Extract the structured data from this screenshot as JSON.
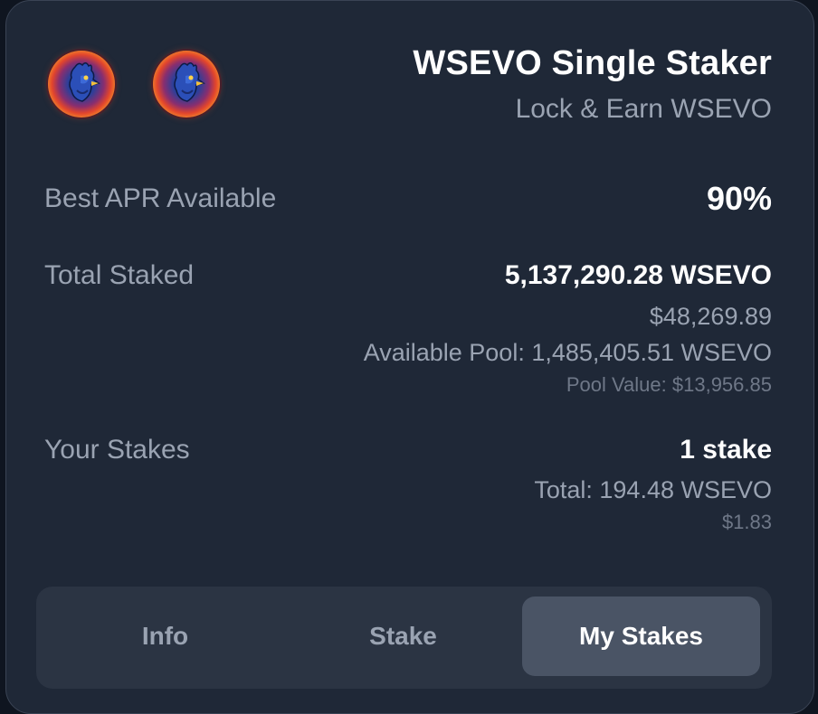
{
  "header": {
    "title": "WSEVO Single Staker",
    "subtitle": "Lock & Earn WSEVO",
    "icons": [
      "rooster-token-icon",
      "rooster-token-icon"
    ]
  },
  "stats": {
    "apr_label": "Best APR Available",
    "apr_value": "90%",
    "total_staked_label": "Total Staked",
    "total_staked_value": "5,137,290.28 WSEVO",
    "total_staked_usd": "$48,269.89",
    "available_pool": "Available Pool: 1,485,405.51 WSEVO",
    "pool_value": "Pool Value: $13,956.85",
    "your_stakes_label": "Your Stakes",
    "your_stakes_count": "1 stake",
    "your_stakes_total": "Total: 194.48 WSEVO",
    "your_stakes_usd": "$1.83"
  },
  "tabs": [
    {
      "label": "Info",
      "active": false
    },
    {
      "label": "Stake",
      "active": false
    },
    {
      "label": "My Stakes",
      "active": true
    }
  ],
  "colors": {
    "card_bg": "#1f2837",
    "muted_text": "#9aa3b2",
    "active_tab_bg": "#4a5465"
  }
}
